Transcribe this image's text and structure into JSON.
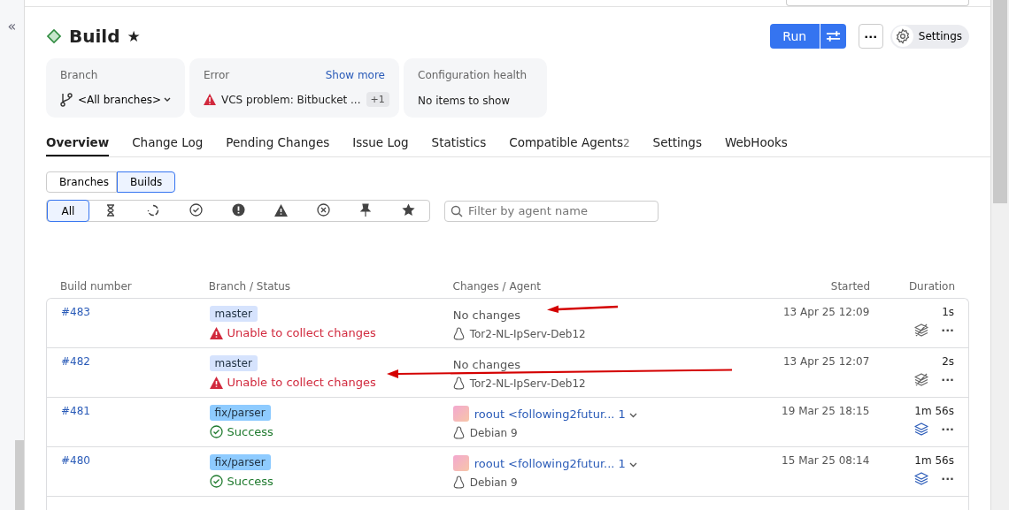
{
  "sidebar": {
    "collapse": "«"
  },
  "page": {
    "title": "Build",
    "star": "★"
  },
  "actions": {
    "run": "Run",
    "more": "···",
    "settings": "Settings"
  },
  "info_cards": [
    {
      "kind": "branch",
      "label": "Branch",
      "value": "<All branches>"
    },
    {
      "kind": "error",
      "label": "Error",
      "link": "Show more",
      "value": "VCS problem: Bitbucket ...",
      "count": "+1"
    },
    {
      "kind": "plain",
      "label": "Configuration health",
      "value": "No items to show"
    }
  ],
  "tabs": [
    {
      "label": "Overview",
      "selected": true
    },
    {
      "label": "Change Log",
      "selected": false
    },
    {
      "label": "Pending Changes",
      "selected": false
    },
    {
      "label": "Issue Log",
      "selected": false
    },
    {
      "label": "Statistics",
      "selected": false
    },
    {
      "label": "Compatible Agents",
      "count": "2",
      "selected": false
    },
    {
      "label": "Settings",
      "selected": false
    },
    {
      "label": "WebHooks",
      "selected": false
    }
  ],
  "view_toggle": [
    {
      "label": "Branches",
      "selected": false
    },
    {
      "label": "Builds",
      "selected": true
    }
  ],
  "status_filters": [
    {
      "kind": "all",
      "label": "All",
      "selected": true
    },
    {
      "kind": "queued",
      "selected": false
    },
    {
      "kind": "running",
      "selected": false
    },
    {
      "kind": "success",
      "selected": false
    },
    {
      "kind": "failed",
      "selected": false
    },
    {
      "kind": "warning",
      "selected": false
    },
    {
      "kind": "canceled",
      "selected": false
    },
    {
      "kind": "pinned",
      "selected": false
    },
    {
      "kind": "starred",
      "selected": false
    }
  ],
  "agent_filter": {
    "placeholder": "Filter by agent name"
  },
  "table": {
    "columns": [
      "Build number",
      "Branch / Status",
      "Changes / Agent",
      "Started",
      "Duration"
    ],
    "rows": [
      {
        "number": "#483",
        "branch": {
          "label": "master",
          "color": "#d6e3fd"
        },
        "status": {
          "kind": "error",
          "text": "Unable to collect changes"
        },
        "changes": {
          "kind": "none",
          "text": "No changes"
        },
        "agent": "Tor2-NL-IpServ-Deb12",
        "started": "13 Apr 25 12:09",
        "duration": "1s",
        "artifacts_disabled": true,
        "more": "···",
        "arrow": {
          "kind": "to_changes"
        }
      },
      {
        "number": "#482",
        "branch": {
          "label": "master",
          "color": "#d6e3fd"
        },
        "status": {
          "kind": "error",
          "text": "Unable to collect changes"
        },
        "changes": {
          "kind": "none",
          "text": "No changes"
        },
        "agent": "Tor2-NL-IpServ-Deb12",
        "started": "13 Apr 25 12:07",
        "duration": "2s",
        "artifacts_disabled": true,
        "more": "···",
        "arrow": {
          "kind": "to_status"
        }
      },
      {
        "number": "#481",
        "branch": {
          "label": "fix/parser",
          "color": "#8ecbff"
        },
        "status": {
          "kind": "success",
          "text": "Success"
        },
        "changes": {
          "kind": "commit",
          "text": "roout <following2futur...",
          "count": "1"
        },
        "agent": "Debian 9",
        "started": "19 Mar 25 18:15",
        "duration": "1m 56s",
        "artifacts_disabled": false,
        "more": "···"
      },
      {
        "number": "#480",
        "branch": {
          "label": "fix/parser",
          "color": "#8ecbff"
        },
        "status": {
          "kind": "success",
          "text": "Success"
        },
        "changes": {
          "kind": "commit",
          "text": "roout <following2futur...",
          "count": "1"
        },
        "agent": "Debian 9",
        "started": "15 Mar 25 08:14",
        "duration": "1m 56s",
        "artifacts_disabled": false,
        "more": "···"
      }
    ]
  }
}
